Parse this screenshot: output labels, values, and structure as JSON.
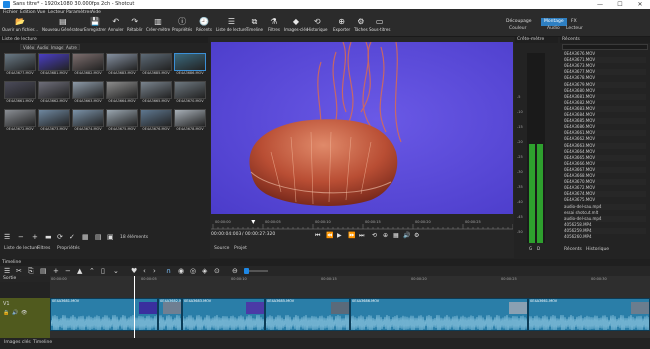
{
  "window": {
    "title": "Sans titre* - 1920x1080 30.000fps 2ch - Shotcut",
    "minimize": "—",
    "maximize": "☐",
    "close": "✕"
  },
  "menu": [
    "Fichier",
    "Édition",
    "Vue",
    "Lecteur",
    "Paramètres",
    "Aide"
  ],
  "toolbar": [
    {
      "label": "Ouvrir un fichier...",
      "icon": "folder-icon",
      "glyph": "📂"
    },
    {
      "label": "Nouveau Générateur",
      "icon": "generator-icon",
      "glyph": "▤"
    },
    {
      "label": "Enregistrer",
      "icon": "save-icon",
      "glyph": "💾"
    },
    {
      "label": "Annuler",
      "icon": "undo-icon",
      "glyph": "↶"
    },
    {
      "label": "Rétablir",
      "icon": "redo-icon",
      "glyph": "↷"
    },
    {
      "label": "Créer-mètre",
      "icon": "peak-meter-icon",
      "glyph": "▥"
    },
    {
      "label": "Propriétés",
      "icon": "properties-icon",
      "glyph": "ⓘ"
    },
    {
      "label": "Récents",
      "icon": "recent-icon",
      "glyph": "🕘"
    },
    {
      "label": "Liste de lecture",
      "icon": "playlist-icon",
      "glyph": "☰"
    },
    {
      "label": "Timeline",
      "icon": "timeline-icon",
      "glyph": "⧉"
    },
    {
      "label": "Filtres",
      "icon": "filters-icon",
      "glyph": "⚗"
    },
    {
      "label": "Images-clés",
      "icon": "keyframes-icon",
      "glyph": "◆"
    },
    {
      "label": "Historique",
      "icon": "history-icon",
      "glyph": "⟲"
    },
    {
      "label": "Exporter",
      "icon": "export-icon",
      "glyph": "⊕"
    },
    {
      "label": "Tâches",
      "icon": "jobs-icon",
      "glyph": "⚙"
    },
    {
      "label": "Sous-titres",
      "icon": "subtitles-icon",
      "glyph": "▭"
    }
  ],
  "layouts": {
    "row1": [
      "Découpage",
      "Montage",
      "FX"
    ],
    "row2": [
      "Couleur",
      "Audio",
      "Lecteur"
    ],
    "active": "Montage"
  },
  "playlist": {
    "title": "Liste de lecture",
    "subtabs": [
      "Vidéo",
      "Audio",
      "Image",
      "Autre"
    ],
    "items": [
      {
        "name": "0E4A3677.MOV",
        "color": "#6a7a86"
      },
      {
        "name": "0E4A3681.MOV",
        "color": "#4a3ec4"
      },
      {
        "name": "0E4A3682.MOV",
        "color": "#7d6e6e"
      },
      {
        "name": "0E4A3683.MOV",
        "color": "#8590a0"
      },
      {
        "name": "0E4A3685.MOV",
        "color": "#5d6a76"
      },
      {
        "name": "0E4A3686.MOV",
        "color": "#3b6a7e"
      },
      {
        "name": "0E4A3661.MOV",
        "color": "#4b4b5a"
      },
      {
        "name": "0E4A3662.MOV",
        "color": "#6e6e7a"
      },
      {
        "name": "0E4A3663.MOV",
        "color": "#8d9aa8"
      },
      {
        "name": "0E4A3664.MOV",
        "color": "#8c8c8c"
      },
      {
        "name": "0E4A3665.MOV",
        "color": "#7a848e"
      },
      {
        "name": "0E4A3670.MOV",
        "color": "#6e7880"
      },
      {
        "name": "0E4A3672.MOV",
        "color": "#8b8f95"
      },
      {
        "name": "0E4A3673.MOV",
        "color": "#6f88a0"
      },
      {
        "name": "0E4A3674.MOV",
        "color": "#7b92a8"
      },
      {
        "name": "0E4A3675.MOV",
        "color": "#9aa6b0"
      },
      {
        "name": "0E4A3676.MOV",
        "color": "#5f7890"
      },
      {
        "name": "0E4A3678.MOV",
        "color": "#a8b0b8"
      }
    ],
    "selected_index": 5,
    "count": "18 éléments",
    "tabs": [
      "Liste de lecture",
      "Filtres",
      "Propriétés"
    ]
  },
  "player": {
    "ruler": [
      "00:00:00",
      "00:00:05",
      "00:00:10",
      "00:00:15",
      "00:00:20",
      "00:00:25"
    ],
    "position": "00:00:04:003",
    "duration": "/ 00:00:27:320",
    "tabs": [
      "Source",
      "Projet"
    ],
    "playhead_fraction": 0.14
  },
  "meter": {
    "title": "Crête-mètre",
    "scale": [
      "-5",
      "-10",
      "-15",
      "-20",
      "-25",
      "-30",
      "-35",
      "-40",
      "-45",
      "-50"
    ],
    "channels": [
      "G",
      "D"
    ],
    "level_fraction": 0.52
  },
  "recent": {
    "title": "Récents",
    "items": [
      "0E4A3676.MOV",
      "0E4A3671.MOV",
      "0E4A3673.MOV",
      "0E4A3677.MOV",
      "0E4A3678.MOV",
      "0E4A3679.MOV",
      "0E4A3680.MOV",
      "0E4A3681.MOV",
      "0E4A3682.MOV",
      "0E4A3683.MOV",
      "0E4A3684.MOV",
      "0E4A3685.MOV",
      "0E4A3686.MOV",
      "0E4A3661.MOV",
      "0E4A3662.MOV",
      "0E4A3663.MOV",
      "0E4A3664.MOV",
      "0E4A3665.MOV",
      "0E4A3666.MOV",
      "0E4A3667.MOV",
      "0E4A3668.MOV",
      "0E4A3670.MOV",
      "0E4A3672.MOV",
      "0E4A3674.MOV",
      "0E4A3675.MOV",
      "audio-del-sau.mp4",
      "essai shotcut.mlt",
      "audio-del-sau.mp4",
      "4056258.MP4",
      "4056259.MP4",
      "4056260.MP4"
    ],
    "tabs": [
      "Récents",
      "Historique"
    ]
  },
  "timeline": {
    "title": "Timeline",
    "output_label": "Sortie",
    "track_name": "V1",
    "ruler": [
      "00:00:00",
      "00:00:05",
      "00:00:10",
      "00:00:15",
      "00:00:20",
      "00:00:25",
      "00:00:30"
    ],
    "clips": [
      {
        "name": "0E4A3681.MOV",
        "color": "#2b7fa9"
      },
      {
        "name": "0E4A3682.MOV",
        "color": "#2b7fa9"
      },
      {
        "name": "0E4A3683.MOV",
        "color": "#2b7fa9"
      },
      {
        "name": "0E4A3685.MOV",
        "color": "#2b7fa9"
      },
      {
        "name": "0E4A3686.MOV",
        "color": "#2b7fa9"
      },
      {
        "name": "0E4A3661.MOV",
        "color": "#2b7fa9"
      }
    ],
    "footer_tabs": [
      "Images clés",
      "Timeline"
    ]
  }
}
